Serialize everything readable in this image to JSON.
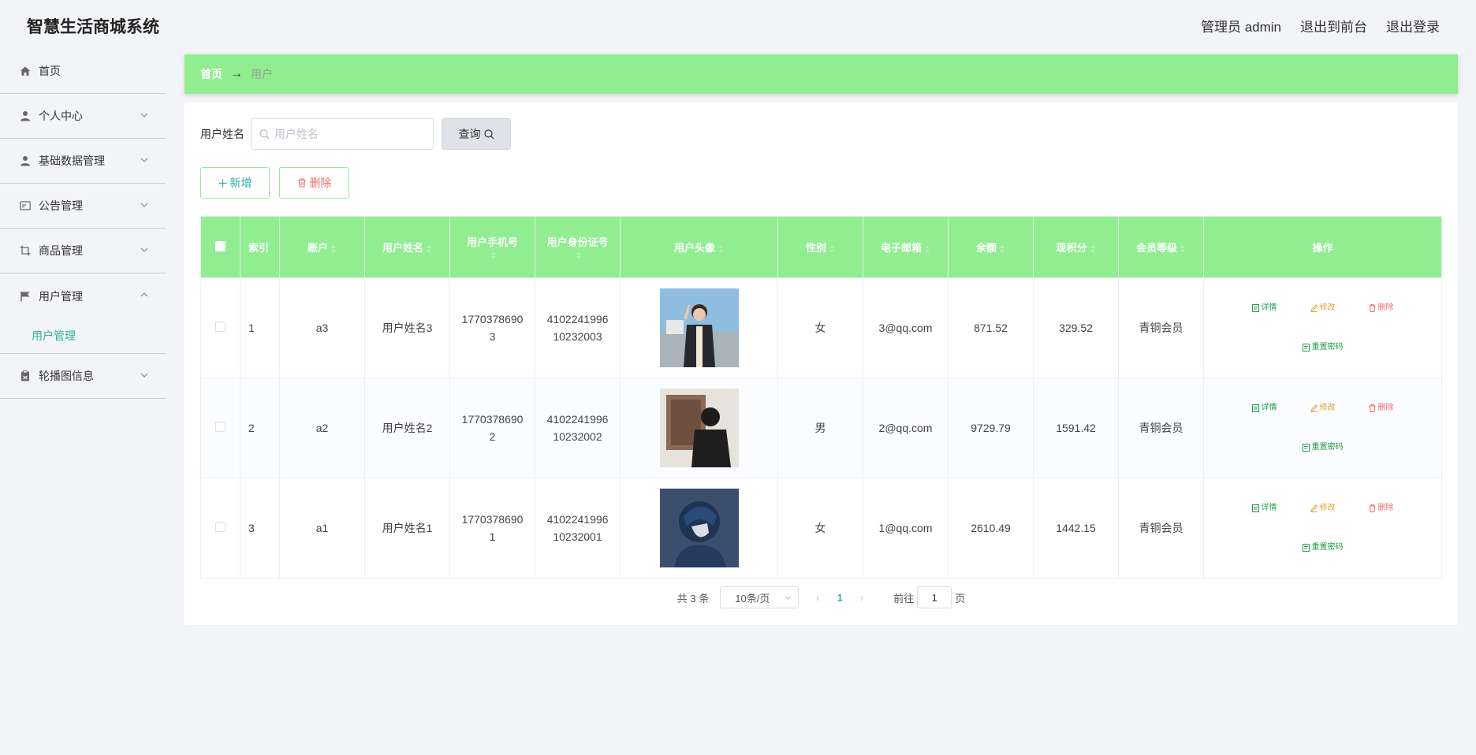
{
  "header": {
    "title": "智慧生活商城系统",
    "admin": "管理员 admin",
    "to_front": "退出到前台",
    "logout": "退出登录"
  },
  "sidebar": {
    "items": [
      {
        "label": "首页",
        "icon": "home-icon",
        "expandable": false
      },
      {
        "label": "个人中心",
        "icon": "user-icon",
        "expandable": true
      },
      {
        "label": "基础数据管理",
        "icon": "user-icon",
        "expandable": true
      },
      {
        "label": "公告管理",
        "icon": "card-icon",
        "expandable": true
      },
      {
        "label": "商品管理",
        "icon": "crop-icon",
        "expandable": true
      },
      {
        "label": "用户管理",
        "icon": "flag-icon",
        "expandable": true,
        "expanded": true
      },
      {
        "label": "轮播图信息",
        "icon": "clipboard-icon",
        "expandable": true
      }
    ],
    "sub_item": "用户管理"
  },
  "breadcrumb": {
    "home": "首页",
    "current": "用户"
  },
  "search": {
    "label": "用户姓名",
    "placeholder": "用户姓名",
    "query_button": "查询"
  },
  "actions": {
    "add": "新增",
    "delete": "删除"
  },
  "table": {
    "headers": {
      "index": "索引",
      "account": "账户",
      "name": "用户姓名",
      "phone": "用户手机号",
      "idcard": "用户身份证号",
      "avatar": "用户头像",
      "gender": "性别",
      "email": "电子邮箱",
      "balance": "余额",
      "points": "现积分",
      "level": "会员等级",
      "ops": "操作"
    },
    "rows": [
      {
        "index": "1",
        "account": "a3",
        "name": "用户姓名3",
        "phone_a": "1770378690",
        "phone_b": "3",
        "id_a": "4102241996",
        "id_b": "10232003",
        "gender": "女",
        "email": "3@qq.com",
        "balance": "871.52",
        "points": "329.52",
        "level": "青铜会员"
      },
      {
        "index": "2",
        "account": "a2",
        "name": "用户姓名2",
        "phone_a": "1770378690",
        "phone_b": "2",
        "id_a": "4102241996",
        "id_b": "10232002",
        "gender": "男",
        "email": "2@qq.com",
        "balance": "9729.79",
        "points": "1591.42",
        "level": "青铜会员"
      },
      {
        "index": "3",
        "account": "a1",
        "name": "用户姓名1",
        "phone_a": "1770378690",
        "phone_b": "1",
        "id_a": "4102241996",
        "id_b": "10232001",
        "gender": "女",
        "email": "1@qq.com",
        "balance": "2610.49",
        "points": "1442.15",
        "level": "青铜会员"
      }
    ],
    "ops": {
      "detail": "详情",
      "edit": "修改",
      "delete": "删除",
      "reset": "重置密码"
    }
  },
  "pager": {
    "total": "共 3 条",
    "page_size": "10条/页",
    "current": "1",
    "goto_prefix": "前往",
    "goto_value": "1",
    "goto_suffix": "页"
  },
  "colors": {
    "accent_green": "#90ee90",
    "teal": "#2bb3a4",
    "danger": "#f56c6c",
    "warning": "#e6a23c"
  }
}
